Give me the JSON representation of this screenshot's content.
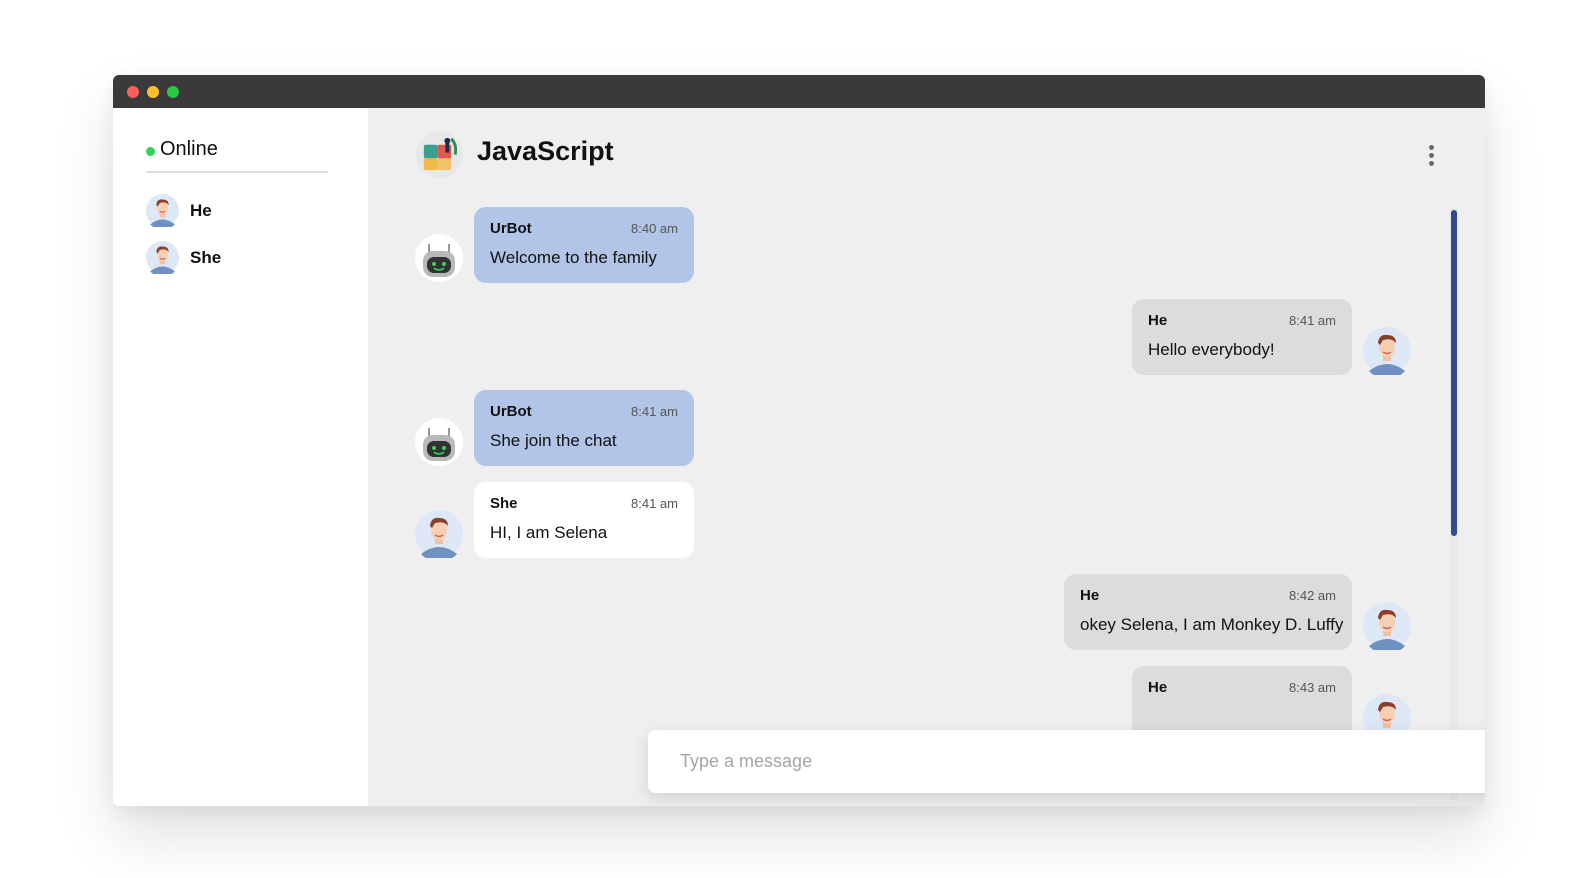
{
  "window": {
    "title_dots": [
      "close",
      "minimize",
      "maximize"
    ]
  },
  "sidebar": {
    "status_label": "Online",
    "status_color": "#2fd158",
    "users": [
      {
        "name": "He",
        "avatar": "male-avatar-icon"
      },
      {
        "name": "She",
        "avatar": "male-avatar-icon"
      }
    ]
  },
  "chat": {
    "title": "JavaScript",
    "header_icon": "group-puzzle-icon",
    "menu_icon": "kebab-menu-icon",
    "messages": [
      {
        "sender": "UrBot",
        "time": "8:40 am",
        "text": "Welcome to the family",
        "side": "left",
        "style": "bot",
        "avatar": "robot-icon"
      },
      {
        "sender": "He",
        "time": "8:41 am",
        "text": "Hello everybody!",
        "side": "right",
        "style": "grey",
        "avatar": "male-avatar-icon"
      },
      {
        "sender": "UrBot",
        "time": "8:41 am",
        "text": "She join the chat",
        "side": "left",
        "style": "bot",
        "avatar": "robot-icon"
      },
      {
        "sender": "She",
        "time": "8:41 am",
        "text": "HI, I am Selena",
        "side": "left",
        "style": "white",
        "avatar": "male-avatar-icon"
      },
      {
        "sender": "He",
        "time": "8:42 am",
        "text": "okey Selena, I am Monkey D. Luffy",
        "side": "right",
        "style": "grey",
        "avatar": "male-avatar-icon"
      },
      {
        "sender": "He",
        "time": "8:43 am",
        "text": "",
        "side": "right",
        "style": "grey",
        "avatar": "male-avatar-icon"
      }
    ],
    "composer": {
      "placeholder": "Type a message",
      "value": "",
      "send_icon": "paper-plane-icon"
    },
    "colors": {
      "bot_bubble": "#b2c4e8",
      "self_bubble": "#dcdcdc",
      "other_bubble": "#ffffff",
      "accent": "#2a4c91"
    }
  }
}
